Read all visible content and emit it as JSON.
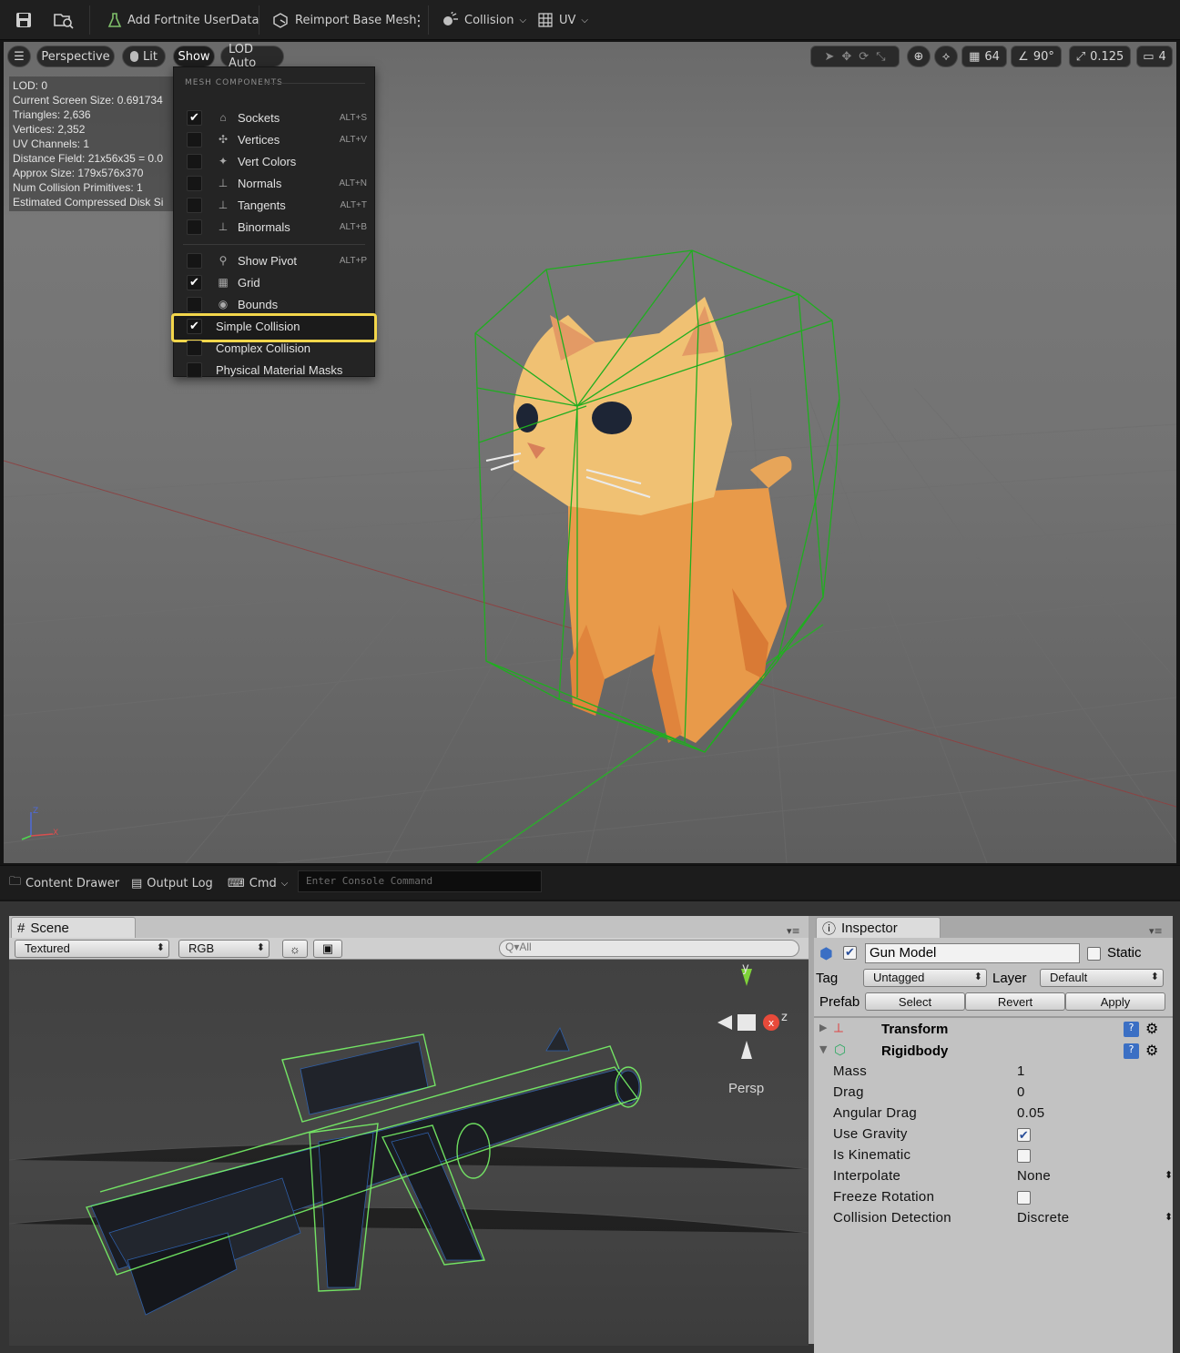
{
  "toolbar": {
    "add_userdata": "Add Fortnite UserData",
    "reimport": "Reimport Base Mesh",
    "collision": "Collision",
    "uv": "UV"
  },
  "viewport": {
    "perspective": "Perspective",
    "lit": "Lit",
    "show": "Show",
    "lod": "LOD Auto",
    "grid_size": "64",
    "angle": "90°",
    "scale": "0.125",
    "camera_speed": "4",
    "stats": [
      "LOD:  0",
      "Current Screen Size:  0.691734",
      "Triangles:  2,636",
      "Vertices:  2,352",
      "UV Channels:  1",
      "Distance Field:  21x56x35 = 0.0",
      "Approx Size: 179x576x370",
      "Num Collision Primitives:  1",
      "Estimated Compressed Disk Si"
    ],
    "axis": {
      "z": "Z",
      "x": "X"
    }
  },
  "show_menu": {
    "header": "MESH COMPONENTS",
    "items": [
      {
        "label": "Sockets",
        "shortcut": "ALT+S",
        "checked": true
      },
      {
        "label": "Vertices",
        "shortcut": "ALT+V",
        "checked": false
      },
      {
        "label": "Vert Colors",
        "shortcut": "",
        "checked": false
      },
      {
        "label": "Normals",
        "shortcut": "ALT+N",
        "checked": false
      },
      {
        "label": "Tangents",
        "shortcut": "ALT+T",
        "checked": false
      },
      {
        "label": "Binormals",
        "shortcut": "ALT+B",
        "checked": false
      },
      {
        "label": "Show Pivot",
        "shortcut": "ALT+P",
        "checked": false
      },
      {
        "label": "Grid",
        "shortcut": "",
        "checked": true
      },
      {
        "label": "Bounds",
        "shortcut": "",
        "checked": false
      },
      {
        "label": "Simple Collision",
        "shortcut": "",
        "checked": true
      },
      {
        "label": "Complex Collision",
        "shortcut": "",
        "checked": false
      },
      {
        "label": "Physical Material Masks",
        "shortcut": "",
        "checked": false
      }
    ]
  },
  "statusbar": {
    "content_drawer": "Content Drawer",
    "output_log": "Output Log",
    "cmd": "Cmd",
    "console_placeholder": "Enter Console Command"
  },
  "unity_scene": {
    "tab": "Scene",
    "draw_mode": "Textured",
    "channel": "RGB",
    "search": "All",
    "gizmo": {
      "y": "y",
      "z": "z",
      "label": "Persp"
    }
  },
  "inspector": {
    "tab": "Inspector",
    "object_name": "Gun Model",
    "static_label": "Static",
    "tag_label": "Tag",
    "tag_value": "Untagged",
    "layer_label": "Layer",
    "layer_value": "Default",
    "prefab_label": "Prefab",
    "prefab_buttons": [
      "Select",
      "Revert",
      "Apply"
    ],
    "components": [
      "Transform",
      "Rigidbody"
    ],
    "rigidbody": [
      {
        "label": "Mass",
        "value": "1"
      },
      {
        "label": "Drag",
        "value": "0"
      },
      {
        "label": "Angular Drag",
        "value": "0.05"
      },
      {
        "label": "Use Gravity",
        "value": "",
        "checkbox": true,
        "checked": true
      },
      {
        "label": "Is Kinematic",
        "value": "",
        "checkbox": true,
        "checked": false
      },
      {
        "label": "Interpolate",
        "value": "None"
      },
      {
        "label": "Freeze Rotation",
        "value": "",
        "checkbox": true,
        "checked": false
      },
      {
        "label": "Collision Detection",
        "value": "Discrete"
      }
    ]
  }
}
